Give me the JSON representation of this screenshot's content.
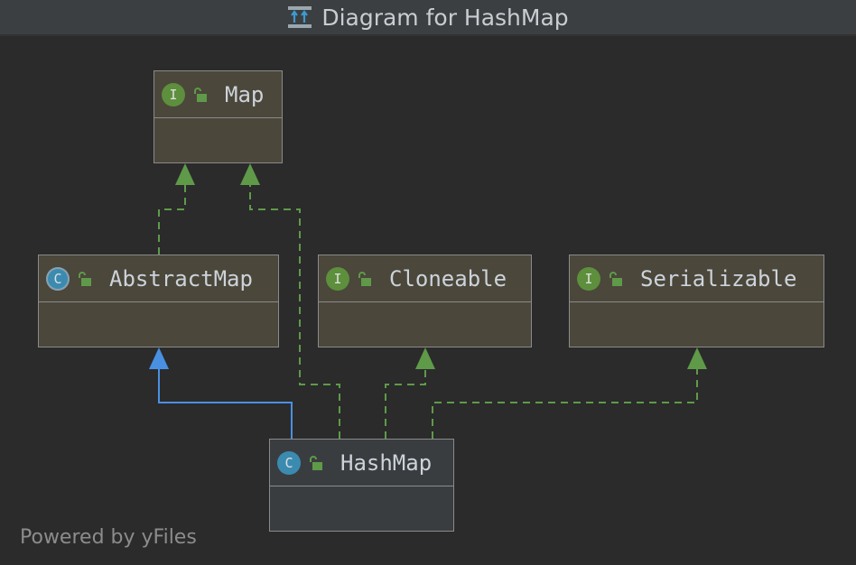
{
  "window": {
    "title": "Diagram for HashMap"
  },
  "footer": {
    "text": "Powered by yFiles"
  },
  "nodes": {
    "map": {
      "name": "Map",
      "kind": "interface",
      "badge": "I"
    },
    "abstract_map": {
      "name": "AbstractMap",
      "kind": "abstract-class",
      "badge": "C"
    },
    "cloneable": {
      "name": "Cloneable",
      "kind": "interface",
      "badge": "I"
    },
    "serializable": {
      "name": "Serializable",
      "kind": "interface",
      "badge": "I"
    },
    "hash_map": {
      "name": "HashMap",
      "kind": "class",
      "badge": "C"
    }
  },
  "edges": [
    {
      "from": "AbstractMap",
      "to": "Map",
      "relation": "implements"
    },
    {
      "from": "HashMap",
      "to": "Map",
      "relation": "implements"
    },
    {
      "from": "HashMap",
      "to": "AbstractMap",
      "relation": "extends"
    },
    {
      "from": "HashMap",
      "to": "Cloneable",
      "relation": "implements"
    },
    {
      "from": "HashMap",
      "to": "Serializable",
      "relation": "implements"
    }
  ],
  "colors": {
    "implements_edge": "#5f9a49",
    "extends_edge": "#4a90e2",
    "interface_fill": "#4b473b",
    "class_fill": "#3a3d40",
    "titlebar": "#3c3f41",
    "background": "#2b2b2b"
  },
  "icons": {
    "title": "class-hierarchy-icon",
    "visibility": "public-lock-icon",
    "interface": "interface-icon",
    "class": "class-icon"
  }
}
